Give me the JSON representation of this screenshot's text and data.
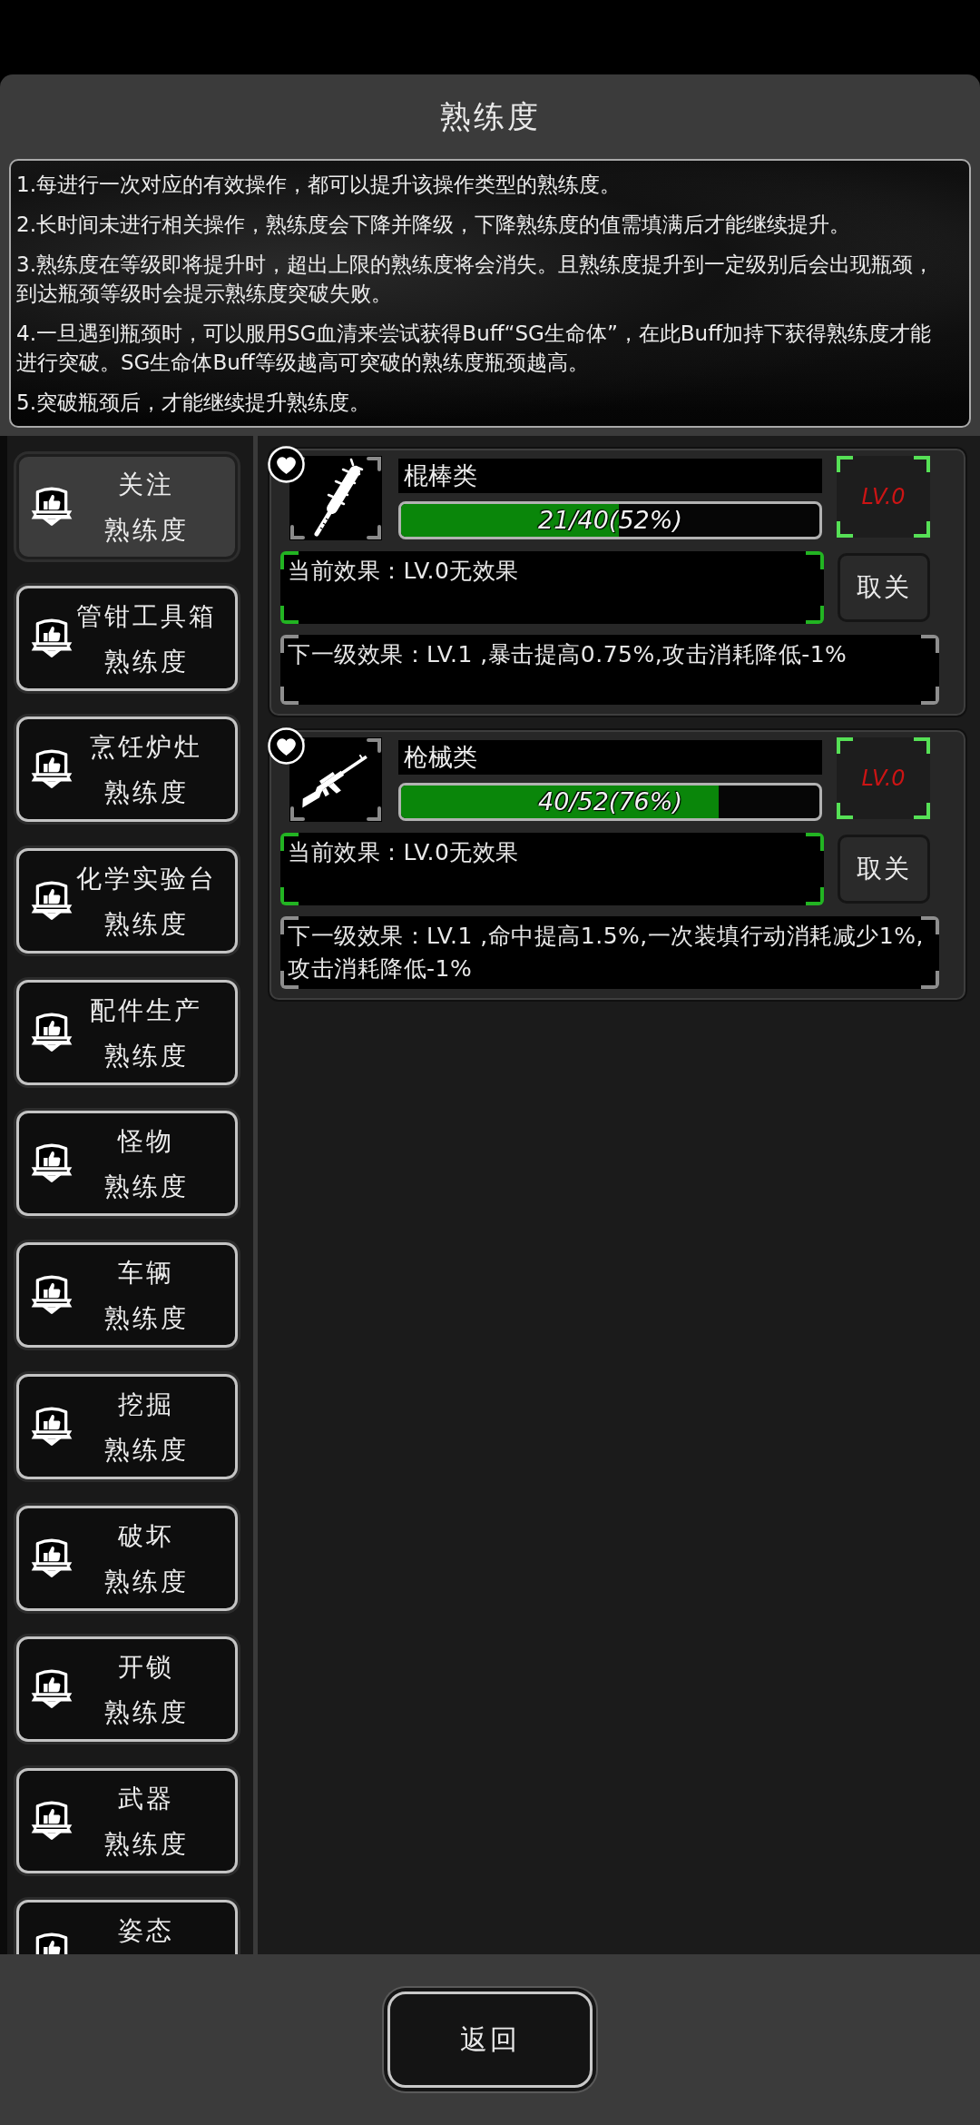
{
  "window": {
    "title": "熟练度"
  },
  "rules": [
    "1.每进行一次对应的有效操作，都可以提升该操作类型的熟练度。",
    "2.长时间未进行相关操作，熟练度会下降并降级，下降熟练度的值需填满后才能继续提升。",
    "3.熟练度在等级即将提升时，超出上限的熟练度将会消失。且熟练度提升到一定级别后会出现瓶颈，到达瓶颈等级时会提示熟练度突破失败。",
    "4.一旦遇到瓶颈时，可以服用SG血清来尝试获得Buff“SG生命体”，在此Buff加持下获得熟练度才能进行突破。SG生命体Buff等级越高可突破的熟练度瓶颈越高。",
    "5.突破瓶颈后，才能继续提升熟练度。"
  ],
  "sidebar": {
    "items": [
      {
        "label": "关注",
        "sublabel": "熟练度",
        "selected": true
      },
      {
        "label": "管钳工具箱",
        "sublabel": "熟练度",
        "selected": false
      },
      {
        "label": "烹饪炉灶",
        "sublabel": "熟练度",
        "selected": false
      },
      {
        "label": "化学实验台",
        "sublabel": "熟练度",
        "selected": false
      },
      {
        "label": "配件生产",
        "sublabel": "熟练度",
        "selected": false
      },
      {
        "label": "怪物",
        "sublabel": "熟练度",
        "selected": false
      },
      {
        "label": "车辆",
        "sublabel": "熟练度",
        "selected": false
      },
      {
        "label": "挖掘",
        "sublabel": "熟练度",
        "selected": false
      },
      {
        "label": "破坏",
        "sublabel": "熟练度",
        "selected": false
      },
      {
        "label": "开锁",
        "sublabel": "熟练度",
        "selected": false
      },
      {
        "label": "武器",
        "sublabel": "熟练度",
        "selected": false
      },
      {
        "label": "姿态",
        "selected": false
      }
    ]
  },
  "cards": [
    {
      "kind": "club",
      "favorited": true,
      "name": "棍棒类",
      "progress": "21/40(52%)",
      "level": 0.52,
      "rank": "LV.0",
      "current_effect": "当前效果：LV.0无效果",
      "button": "取关",
      "next_effect": "下一级效果：LV.1 ,暴击提高0.75%,攻击消耗降低-1%"
    },
    {
      "kind": "gun",
      "favorited": true,
      "name": "枪械类",
      "progress": "40/52(76%)",
      "level": 0.76,
      "rank": "LV.0",
      "current_effect": "当前效果：LV.0无效果",
      "button": "取关",
      "next_effect": "下一级效果：LV.1 ,命中提高1.5%,一次装填行动消耗减少1%,攻击消耗降低-1%"
    }
  ],
  "footer": {
    "button": "返回"
  }
}
